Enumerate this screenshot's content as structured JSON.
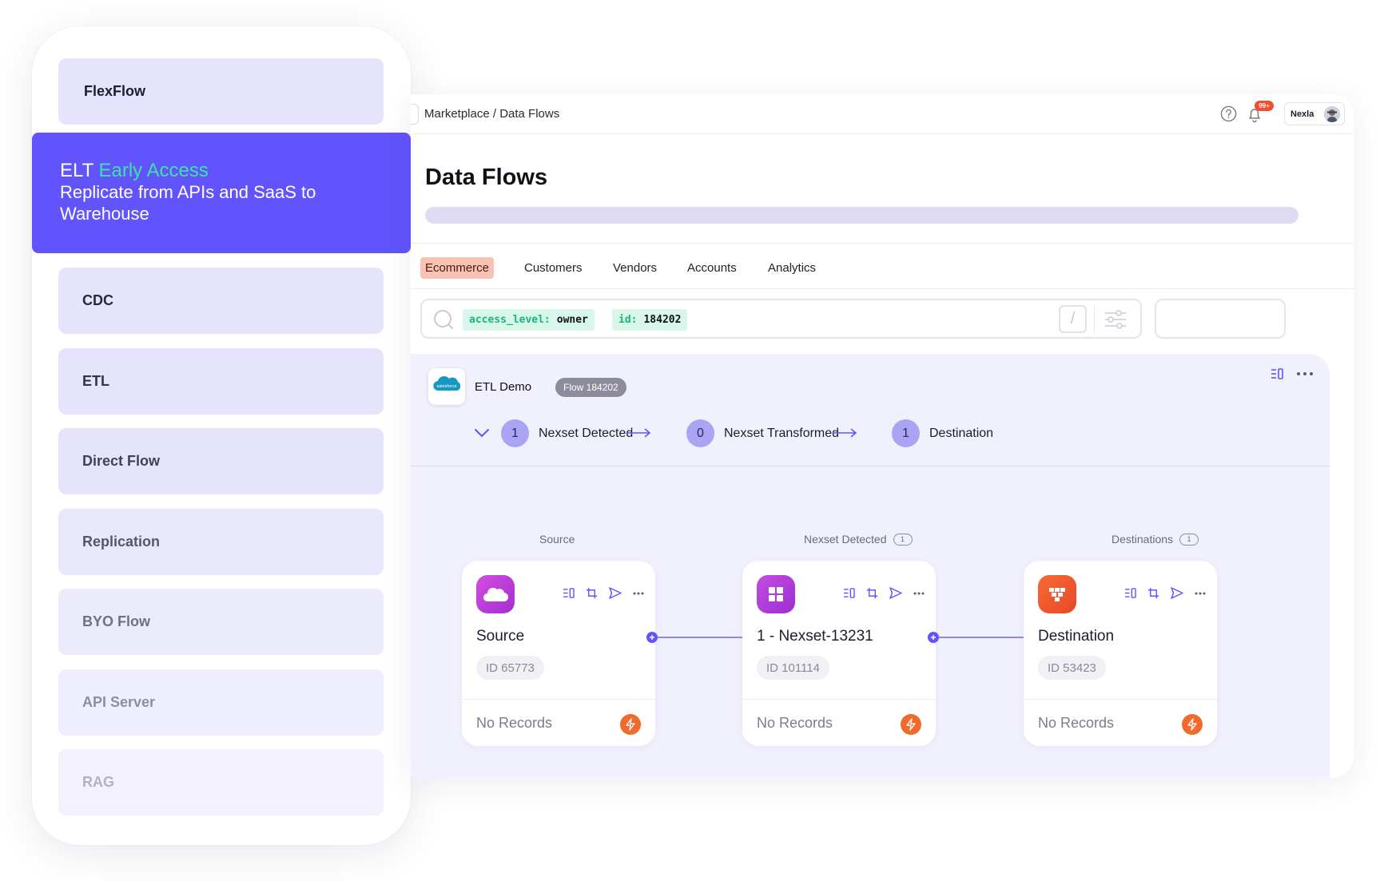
{
  "sidebar": {
    "items": [
      {
        "label": "FlexFlow",
        "color": "#1d1d2b"
      },
      {
        "label": "CDC",
        "color": "#2a2a3a"
      },
      {
        "label": "ETL",
        "color": "#343446"
      },
      {
        "label": "Direct Flow",
        "color": "#414154"
      },
      {
        "label": "Replication",
        "color": "#56566a"
      },
      {
        "label": "BYO Flow",
        "color": "#707083"
      },
      {
        "label": "API Server",
        "color": "#8e8ea0"
      },
      {
        "label": "RAG",
        "color": "#b2b2c0"
      }
    ],
    "highlight": {
      "title": "ELT",
      "accent": "Early Access",
      "description": "Replicate from APIs and SaaS to Warehouse"
    }
  },
  "header": {
    "breadcrumb": "Marketplace / Data Flows",
    "notification_badge": "99+",
    "user": "Nexla"
  },
  "page": {
    "title": "Data Flows",
    "tabs": [
      "Ecommerce",
      "Customers",
      "Vendors",
      "Accounts",
      "Analytics"
    ],
    "active_tab": "Ecommerce"
  },
  "search": {
    "chips": [
      {
        "key": "access_level:",
        "value": "owner"
      },
      {
        "key": "id:",
        "value": "184202"
      }
    ],
    "shortcut": "/"
  },
  "flow": {
    "logo_text": "salesforce",
    "name": "ETL Demo",
    "badge": "Flow 184202",
    "steps": [
      {
        "count": "1",
        "label": "Nexset Detected"
      },
      {
        "count": "0",
        "label": "Nexset Transformed"
      },
      {
        "count": "1",
        "label": "Destination"
      }
    ],
    "columns": [
      {
        "label": "Source",
        "count": null
      },
      {
        "label": "Nexset Detected",
        "count": "1"
      },
      {
        "label": "Destinations",
        "count": "1"
      }
    ],
    "nodes": [
      {
        "title": "Source",
        "id": "ID 65773",
        "status": "No Records",
        "icon": "salesforce-cloud-icon",
        "color": "#c13fd8"
      },
      {
        "title": "1 - Nexset-13231",
        "id": "ID 101114",
        "status": "No Records",
        "icon": "nexset-grid-icon",
        "color": "#b23ad6"
      },
      {
        "title": "Destination",
        "id": "ID 53423",
        "status": "No Records",
        "icon": "warehouse-icon",
        "color": "#f05a2c"
      }
    ]
  },
  "colors": {
    "primary": "#6254fc",
    "accent_green": "#3de3a3",
    "tab_active_bg": "#fbc2b3",
    "panel_bg": "#f1f0fd",
    "connector": "#8f84f5"
  }
}
